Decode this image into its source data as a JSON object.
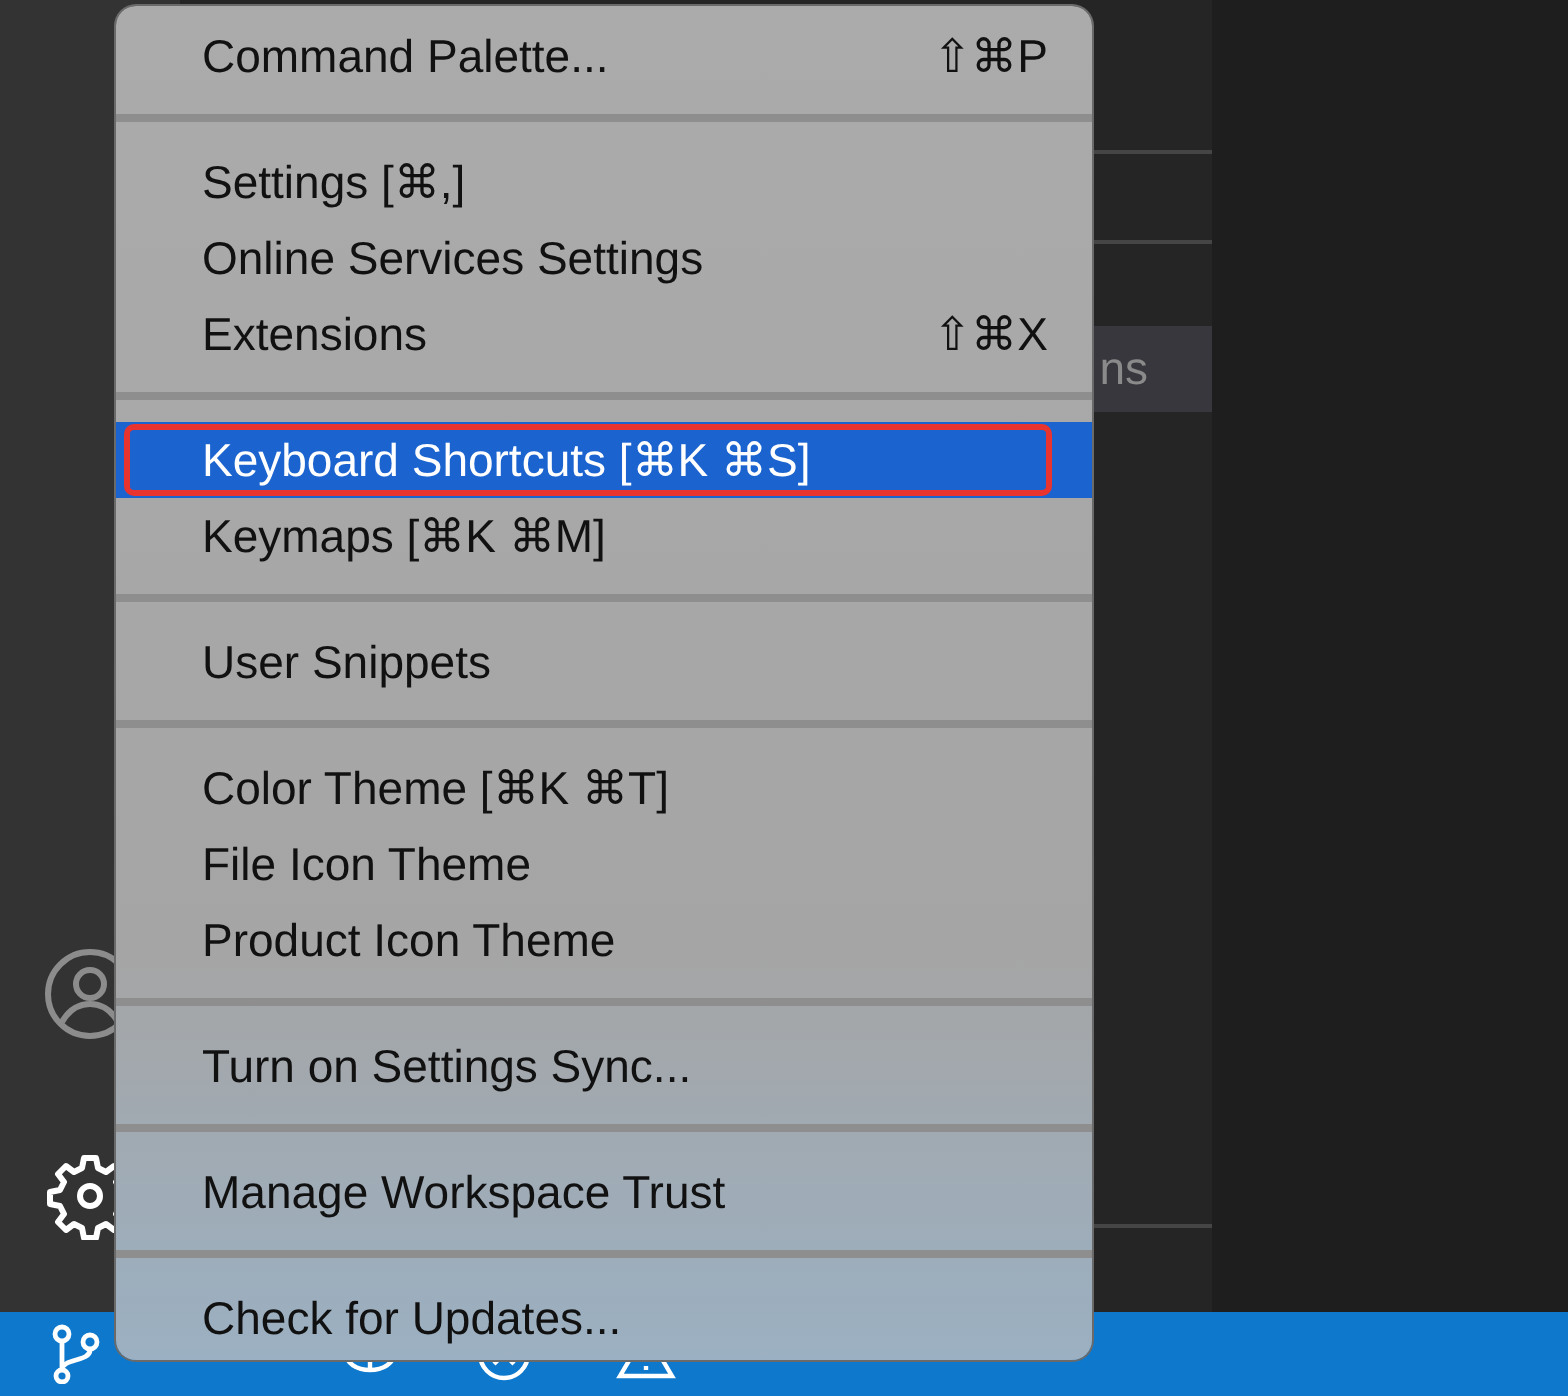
{
  "sidebar": {
    "items": [
      {
        "label": "ns",
        "selected": true
      }
    ]
  },
  "menu": {
    "groups": [
      [
        {
          "label": "Command Palette...",
          "shortcut": "⇧⌘P",
          "selected": false,
          "outlined": false
        }
      ],
      [
        {
          "label": "Settings [⌘,]",
          "selected": false,
          "outlined": false
        },
        {
          "label": "Online Services Settings",
          "selected": false,
          "outlined": false
        },
        {
          "label": "Extensions",
          "shortcut": "⇧⌘X",
          "selected": false,
          "outlined": false
        }
      ],
      [
        {
          "label": "Keyboard Shortcuts [⌘K ⌘S]",
          "selected": true,
          "outlined": true
        },
        {
          "label": "Keymaps [⌘K ⌘M]",
          "selected": false,
          "outlined": false
        }
      ],
      [
        {
          "label": "User Snippets",
          "selected": false,
          "outlined": false
        }
      ],
      [
        {
          "label": "Color Theme [⌘K ⌘T]",
          "selected": false,
          "outlined": false
        },
        {
          "label": "File Icon Theme",
          "selected": false,
          "outlined": false
        },
        {
          "label": "Product Icon Theme",
          "selected": false,
          "outlined": false
        }
      ],
      [
        {
          "label": "Turn on Settings Sync...",
          "selected": false,
          "outlined": false
        }
      ],
      [
        {
          "label": "Manage Workspace Trust",
          "selected": false,
          "outlined": false
        }
      ],
      [
        {
          "label": "Check for Updates...",
          "selected": false,
          "outlined": false
        }
      ]
    ]
  }
}
